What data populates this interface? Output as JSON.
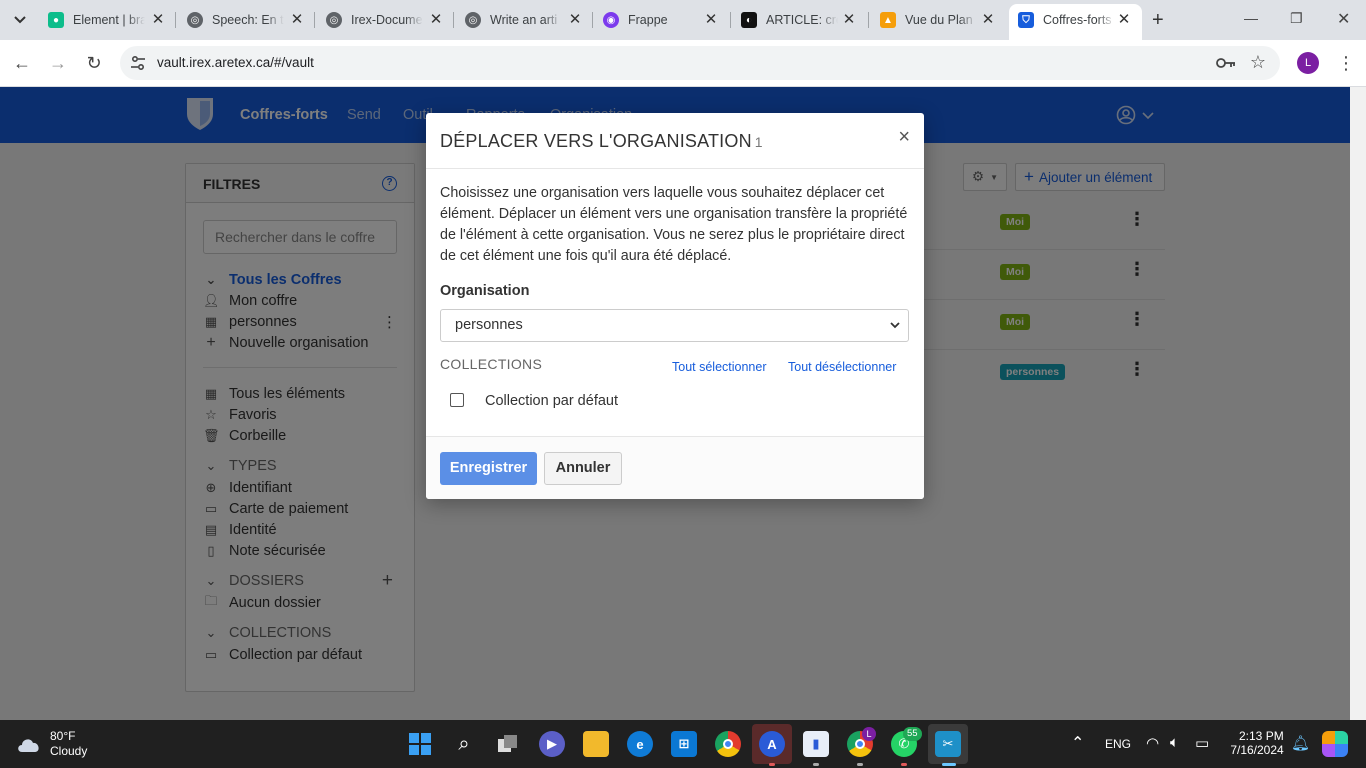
{
  "browser": {
    "tabs": [
      {
        "title": "Element | bra",
        "favicon_color": "#0dbd8b"
      },
      {
        "title": "Speech: En ta",
        "favicon_color": "#5f6368"
      },
      {
        "title": "Irex-Docume",
        "favicon_color": "#5f6368"
      },
      {
        "title": "Write an arti",
        "favicon_color": "#5f6368"
      },
      {
        "title": "Frappe",
        "favicon_color": "#7c3aed"
      },
      {
        "title": "ARTICLE: cré",
        "favicon_color": "#111111"
      },
      {
        "title": "Vue du Plan",
        "favicon_color": "#f59e0b"
      },
      {
        "title": "Coffres-forts",
        "favicon_color": "#175ddc"
      }
    ],
    "active_tab": 7,
    "url": "vault.irex.aretex.ca/#/vault",
    "profile_initial": "L"
  },
  "app": {
    "nav": {
      "items": [
        "Coffres-forts",
        "Send",
        "Outil",
        "Rapports",
        "Organisation"
      ],
      "active": 0
    },
    "filters": {
      "title": "FILTRES",
      "search_placeholder": "Rechercher dans le coffre",
      "vaults": [
        {
          "label": "Tous les Coffres",
          "icon": "chevron-down"
        },
        {
          "label": "Mon coffre",
          "icon": "user-icon"
        },
        {
          "label": "personnes",
          "icon": "building-icon"
        },
        {
          "label": "Nouvelle organisation",
          "icon": "plus-icon"
        }
      ],
      "items": [
        {
          "label": "Tous les éléments",
          "icon": "grid-icon"
        },
        {
          "label": "Favoris",
          "icon": "star-icon"
        },
        {
          "label": "Corbeille",
          "icon": "trash-icon"
        }
      ],
      "types_header": "TYPES",
      "types": [
        {
          "label": "Identifiant",
          "icon": "globe-icon"
        },
        {
          "label": "Carte de paiement",
          "icon": "credit-card-icon"
        },
        {
          "label": "Identité",
          "icon": "id-card-icon"
        },
        {
          "label": "Note sécurisée",
          "icon": "note-icon"
        }
      ],
      "folders_header": "DOSSIERS",
      "folders": [
        {
          "label": "Aucun dossier",
          "icon": "folder-icon"
        }
      ],
      "collections_header": "COLLECTIONS",
      "collections": [
        {
          "label": "Collection par défaut",
          "icon": "collection-icon"
        }
      ]
    },
    "toolbar": {
      "add_label": "Ajouter un élément"
    },
    "rows": [
      {
        "badge": "Moi",
        "badge_color": "#81b512"
      },
      {
        "badge": "Moi",
        "badge_color": "#81b512"
      },
      {
        "badge": "Moi",
        "badge_color": "#81b512"
      },
      {
        "badge": "personnes",
        "badge_color": "#17a2b8"
      }
    ]
  },
  "modal": {
    "title": "DÉPLACER VERS L'ORGANISATION",
    "count": "1",
    "description": "Choisissez une organisation vers laquelle vous souhaitez déplacer cet élément. Déplacer un élément vers une organisation transfère la propriété de l'élément à cette organisation. Vous ne serez plus le propriétaire direct de cet élément une fois qu'il aura été déplacé.",
    "org_label": "Organisation",
    "org_value": "personnes",
    "collections_header": "COLLECTIONS",
    "select_all": "Tout sélectionner",
    "deselect_all": "Tout désélectionner",
    "collection_item": "Collection par défaut",
    "collection_checked": false,
    "save_label": "Enregistrer",
    "cancel_label": "Annuler"
  },
  "taskbar": {
    "weather_temp": "80°F",
    "weather_desc": "Cloudy",
    "language": "ENG",
    "time": "2:13 PM",
    "date": "7/16/2024",
    "whatsapp_badge": "55",
    "chrome_badge": "L"
  }
}
